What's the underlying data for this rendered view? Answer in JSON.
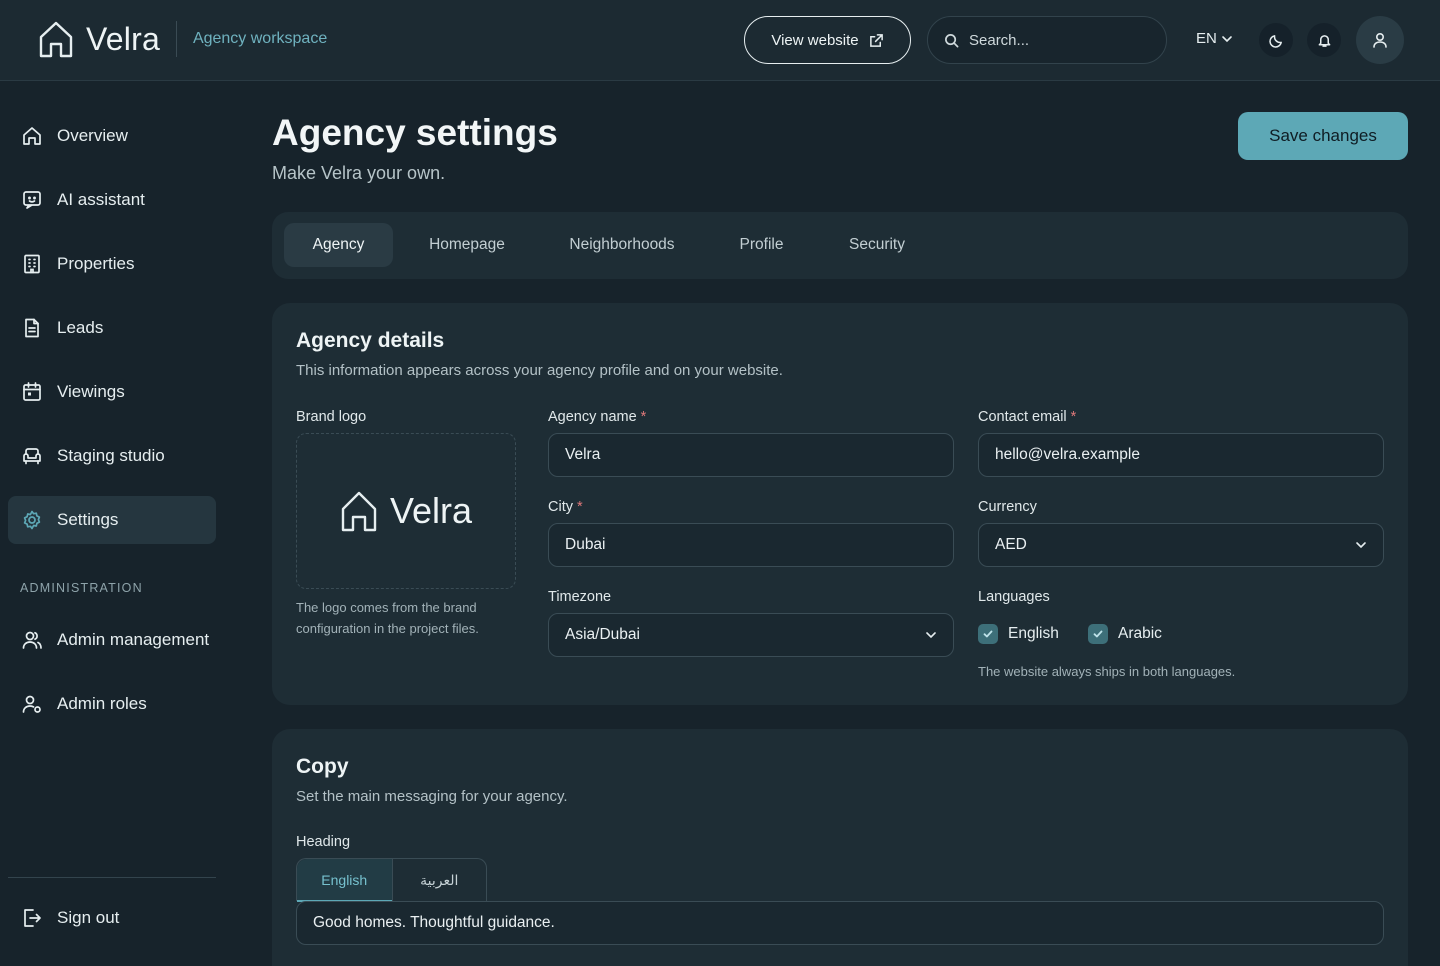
{
  "header": {
    "brand_name": "Velra",
    "workspace": "Agency workspace",
    "view_website": "View website",
    "search_placeholder": "Search...",
    "language": "EN"
  },
  "sidebar": {
    "items": [
      {
        "label": "Overview",
        "icon": "home-icon"
      },
      {
        "label": "AI assistant",
        "icon": "chat-icon"
      },
      {
        "label": "Properties",
        "icon": "building-icon"
      },
      {
        "label": "Leads",
        "icon": "document-icon"
      },
      {
        "label": "Viewings",
        "icon": "calendar-icon"
      },
      {
        "label": "Staging studio",
        "icon": "sofa-icon"
      },
      {
        "label": "Settings",
        "icon": "gear-icon",
        "active": true
      }
    ],
    "admin_section": "ADMINISTRATION",
    "admin_items": [
      {
        "label": "Admin management",
        "icon": "users-icon"
      },
      {
        "label": "Admin roles",
        "icon": "user-key-icon"
      }
    ],
    "sign_out": "Sign out"
  },
  "page": {
    "title": "Agency settings",
    "subtitle": "Make Velra your own.",
    "save_label": "Save changes"
  },
  "tabs": [
    "Agency",
    "Homepage",
    "Neighborhoods",
    "Profile",
    "Security"
  ],
  "agency_details": {
    "title": "Agency details",
    "subtitle": "This information appears across your agency profile and on your website.",
    "brand_logo_label": "Brand logo",
    "logo_text": "Velra",
    "logo_help": "The logo comes from the brand configuration in the project files.",
    "agency_name_label": "Agency name",
    "agency_name": "Velra",
    "contact_email_label": "Contact email",
    "contact_email": "hello@velra.example",
    "city_label": "City",
    "city": "Dubai",
    "currency_label": "Currency",
    "currency": "AED",
    "timezone_label": "Timezone",
    "timezone": "Asia/Dubai",
    "languages_label": "Languages",
    "languages": [
      {
        "label": "English",
        "checked": true
      },
      {
        "label": "Arabic",
        "checked": true
      }
    ],
    "languages_help": "The website always ships in both languages.",
    "required_mark": "*"
  },
  "copy": {
    "title": "Copy",
    "subtitle": "Set the main messaging for your agency.",
    "heading_label": "Heading",
    "lang_tabs": [
      "English",
      "العربية"
    ],
    "heading_value": "Good homes. Thoughtful guidance."
  },
  "colors": {
    "accent": "#5da8b6",
    "background": "#17232b",
    "card": "#1e2d35",
    "required": "#e0787a"
  }
}
